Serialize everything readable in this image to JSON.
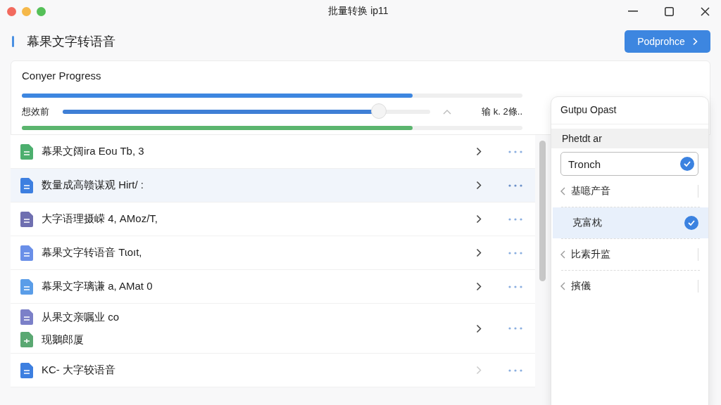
{
  "window": {
    "title": "批量转换 ip11"
  },
  "header": {
    "title": "幕果文字转语音",
    "button": "Podprohce"
  },
  "progress": {
    "title": "Conyer Progress",
    "level": 0.78,
    "slider": {
      "label": "想效前",
      "level": 0.86,
      "reading": "输 k. 2條.."
    },
    "secondary": {
      "level": 0.78
    }
  },
  "files": [
    {
      "label": "幕果文阔ira Eou Tb, 3",
      "color": "#4caf6e",
      "selected": false,
      "chevron_disabled": false
    },
    {
      "label": "数量成高赣谋观 Hirt/ :",
      "color": "#3d7fe0",
      "selected": true,
      "chevron_disabled": false
    },
    {
      "label": "大字语理摄嵘 4, AMoz/T,",
      "color": "#6f6fb0",
      "selected": false,
      "chevron_disabled": false
    },
    {
      "label": "幕果文字转语音 Tɩoıt,",
      "color": "#6a8fe8",
      "selected": false,
      "chevron_disabled": false
    },
    {
      "label": "幕果文字璃谦 a, AMat 0",
      "color": "#5a9de8",
      "selected": false,
      "chevron_disabled": false
    },
    {
      "label": "从果文亲嘱业 co",
      "color": "#7b80c8",
      "selected": false,
      "chevron_disabled": false,
      "sub": {
        "label": "现鵝郎厦",
        "color": "#5aa872"
      }
    },
    {
      "label": "KC- 大字较语音",
      "color": "#3d7fe0",
      "selected": false,
      "chevron_disabled": true
    }
  ],
  "output_menu": {
    "title": "Gutpu Opast",
    "section": "Phetdt ar",
    "field": {
      "value": "Tronch",
      "checked": true
    },
    "items": [
      {
        "label": "基噫产音",
        "kind": "submenu",
        "selected": false
      },
      {
        "label": "克富枕",
        "kind": "option",
        "selected": true
      },
      {
        "label": "比素升监",
        "kind": "submenu",
        "selected": false
      },
      {
        "label": "擯儀",
        "kind": "submenu",
        "selected": false
      }
    ]
  }
}
